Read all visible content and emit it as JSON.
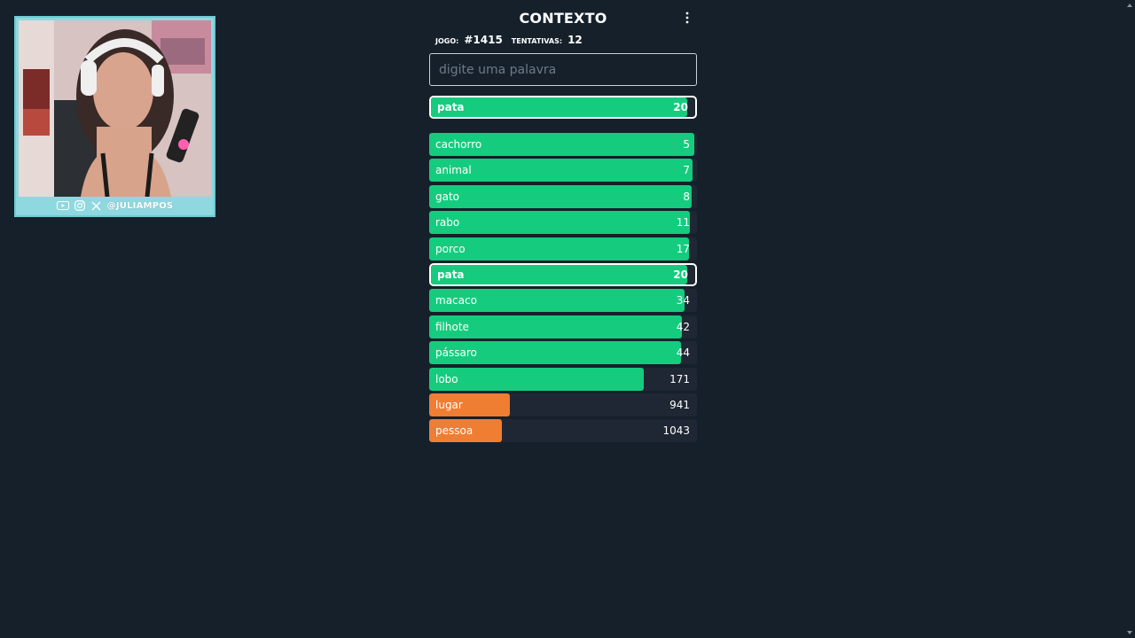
{
  "webcam": {
    "handle": "@JULIAMPOS",
    "icons": [
      "youtube-icon",
      "instagram-icon",
      "x-icon"
    ],
    "frame_color": "#8fd8e0"
  },
  "game": {
    "title": "CONTEXTO",
    "game_label": "JOGO:",
    "game_number": "#1415",
    "attempts_label": "TENTATIVAS:",
    "attempts": "12",
    "input_placeholder": "digite uma palavra",
    "input_value": "",
    "colors": {
      "green": "#15cc7e",
      "orange": "#ef7d32",
      "track": "#1e2733"
    },
    "last_guess": {
      "word": "pata",
      "rank": "20",
      "fill": 0.97,
      "color": "green"
    },
    "guesses": [
      {
        "word": "cachorro",
        "rank": "5",
        "fill": 0.99,
        "color": "green"
      },
      {
        "word": "animal",
        "rank": "7",
        "fill": 0.985,
        "color": "green"
      },
      {
        "word": "gato",
        "rank": "8",
        "fill": 0.98,
        "color": "green"
      },
      {
        "word": "rabo",
        "rank": "11",
        "fill": 0.975,
        "color": "green"
      },
      {
        "word": "porco",
        "rank": "17",
        "fill": 0.97,
        "color": "green"
      },
      {
        "word": "pata",
        "rank": "20",
        "fill": 0.97,
        "color": "green",
        "current": true
      },
      {
        "word": "macaco",
        "rank": "34",
        "fill": 0.955,
        "color": "green"
      },
      {
        "word": "filhote",
        "rank": "42",
        "fill": 0.945,
        "color": "green"
      },
      {
        "word": "pássaro",
        "rank": "44",
        "fill": 0.94,
        "color": "green"
      },
      {
        "word": "lobo",
        "rank": "171",
        "fill": 0.8,
        "color": "green"
      },
      {
        "word": "lugar",
        "rank": "941",
        "fill": 0.3,
        "color": "orange"
      },
      {
        "word": "pessoa",
        "rank": "1043",
        "fill": 0.27,
        "color": "orange"
      }
    ]
  }
}
